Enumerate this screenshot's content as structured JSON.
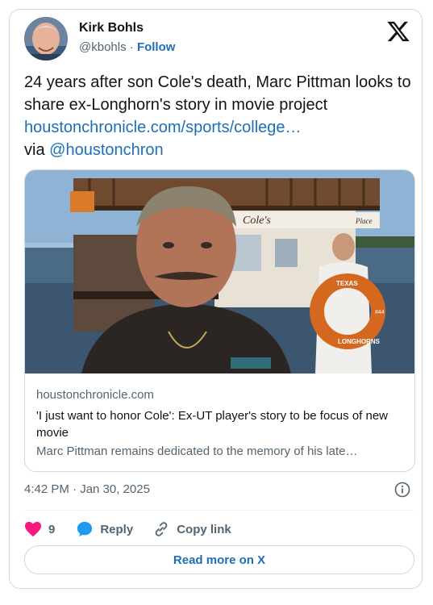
{
  "author": {
    "name": "Kirk Bohls",
    "handle": "@kbohls",
    "separator": "·",
    "follow": "Follow"
  },
  "tweet": {
    "text": "24 years after son Cole's death, Marc Pittman looks to share ex-Longhorn's story in movie project",
    "link": "houstonchronicle.com/sports/college…",
    "via": "via",
    "mention": "@houstonchron"
  },
  "card": {
    "photo_sign": "Cole's",
    "photo_sign_sub": "Place",
    "life_ring_top": "TEXAS",
    "life_ring_bottom": "LONGHORNS",
    "life_ring_num": "#44",
    "domain": "houstonchronicle.com",
    "title": "'I just want to honor Cole': Ex-UT player's story to be focus of new movie",
    "description": "Marc Pittman remains dedicated to the memory of his late…"
  },
  "timestamp": "4:42 PM · Jan 30, 2025",
  "actions": {
    "likes": "9",
    "reply": "Reply",
    "copy": "Copy link"
  },
  "read_more": "Read more on X",
  "colors": {
    "link": "#1d6fb8",
    "heart": "#f91880",
    "reply": "#1d9bf0"
  }
}
